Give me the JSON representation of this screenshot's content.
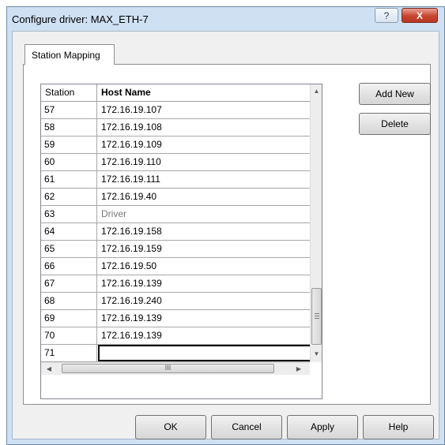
{
  "window": {
    "title": "Configure driver: MAX_ETH-7",
    "help_glyph": "?",
    "close_glyph": "X"
  },
  "tabs": [
    {
      "label": "Station Mapping"
    }
  ],
  "table": {
    "columns": [
      "Station",
      "Host Name"
    ],
    "rows": [
      {
        "station": "57",
        "host": "172.16.19.107"
      },
      {
        "station": "58",
        "host": "172.16.19.108"
      },
      {
        "station": "59",
        "host": "172.16.19.109"
      },
      {
        "station": "60",
        "host": "172.16.19.110"
      },
      {
        "station": "61",
        "host": "172.16.19.111"
      },
      {
        "station": "62",
        "host": "172.16.19.40"
      },
      {
        "station": "63",
        "host": "Driver"
      },
      {
        "station": "64",
        "host": "172.16.19.158"
      },
      {
        "station": "65",
        "host": "172.16.19.159"
      },
      {
        "station": "66",
        "host": "172.16.19.50"
      },
      {
        "station": "67",
        "host": "172.16.19.139"
      },
      {
        "station": "68",
        "host": "172.16.19.240"
      },
      {
        "station": "69",
        "host": "172.16.19.139"
      },
      {
        "station": "70",
        "host": "172.16.19.139"
      },
      {
        "station": "71",
        "host": ""
      }
    ],
    "editing_row_index": 14
  },
  "side_buttons": {
    "add_new": "Add New",
    "delete": "Delete"
  },
  "dialog_buttons": {
    "ok": "OK",
    "cancel": "Cancel",
    "apply": "Apply",
    "help": "Help"
  },
  "scrollbar": {
    "horizontal_grip": "III"
  },
  "icons": {
    "scroll_up": "▲",
    "scroll_down": "▼",
    "scroll_left": "◀",
    "scroll_right": "▶"
  },
  "colors": {
    "title_bar": "#cfe0f3",
    "close_button": "#c7452f",
    "dialog_background": "#f0f0f0",
    "muted_text": "#777777"
  }
}
